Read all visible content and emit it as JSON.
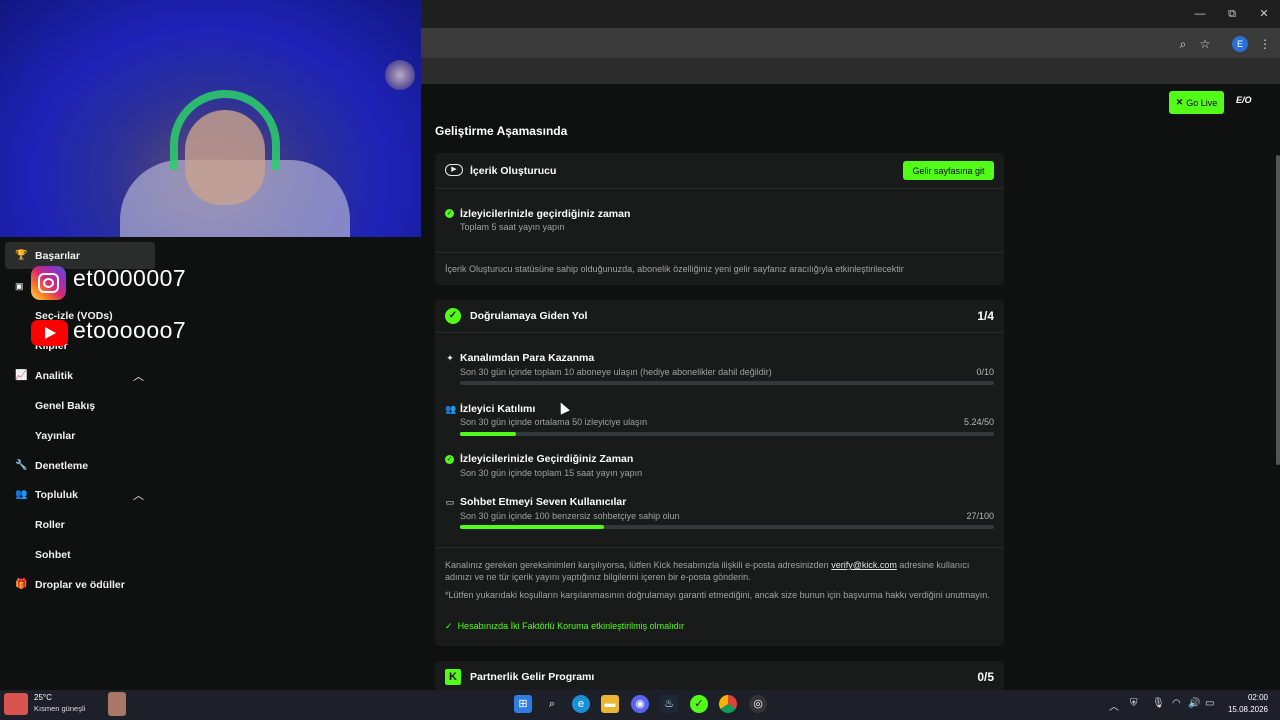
{
  "browser": {
    "window_controls": {
      "minimize": "—",
      "restore": "⧉",
      "close": "✕"
    },
    "toolbar": {
      "zoom_icon": "zoom-icon",
      "bookmark_icon": "star-icon",
      "profile_initial": "E",
      "menu_icon": "kebab-icon"
    }
  },
  "header": {
    "go_live_label": "Go Live",
    "logo_text": "E/O"
  },
  "sidebar": {
    "items": [
      {
        "label": "Başarılar",
        "icon": "trophy-icon"
      },
      {
        "label": "Seç-izle (VODs)"
      },
      {
        "label": "Klipler"
      },
      {
        "label": "Analitik",
        "icon": "chart-icon"
      },
      {
        "label": "Genel Bakış"
      },
      {
        "label": "Yayınlar"
      },
      {
        "label": "Denetleme",
        "icon": "wrench-icon"
      },
      {
        "label": "Topluluk",
        "icon": "people-icon"
      },
      {
        "label": "Roller"
      },
      {
        "label": "Sohbet"
      },
      {
        "label": "Droplar ve ödüller",
        "icon": "gift-icon"
      }
    ]
  },
  "overlay": {
    "instagram_handle": "et0000007",
    "youtube_handle": "etoooooo7"
  },
  "main": {
    "section_title": "Geliştirme Aşamasında",
    "creator_card": {
      "title": "İçerik Oluşturucu",
      "button_label": "Gelir sayfasına git",
      "req_title": "İzleyicilerinizle geçirdiğiniz zaman",
      "req_sub": "Toplam 5 saat yayın yapın",
      "footer": "İçerik Oluşturucu statüsüne sahip olduğunuzda, abonelik özelliğiniz yeni gelir sayfanız aracılığıyla etkinleştirilecektir"
    },
    "verify_card": {
      "title": "Doğrulamaya Giden Yol",
      "progress": "1/4",
      "requirements": [
        {
          "title": "Kanalımdan Para Kazanma",
          "sub": "Son 30 gün içinde toplam 10 aboneye ulaşın (hediye abonelikler dahil değildir)",
          "count": "0/10",
          "fraction": 0
        },
        {
          "title": "İzleyici Katılımı",
          "sub": "Son 30 gün içinde ortalama 50 izleyiciye ulaşın",
          "count": "5.24/50",
          "fraction": 0.1048
        },
        {
          "title": "İzleyicilerinizle Geçirdiğiniz Zaman",
          "sub": "Son 30 gün içinde toplam 15 saat yayın yapın",
          "count": "",
          "fraction": null
        },
        {
          "title": "Sohbet Etmeyi Seven Kullanıcılar",
          "sub": "Son 30 gün içinde 100 benzersiz sohbetçiye sahip olun",
          "count": "27/100",
          "fraction": 0.27
        }
      ],
      "note_pre": "Kanalınız gereken gereksinimleri karşılıyorsa, lütfen Kick hesabınızla ilişkili e-posta adresinizden",
      "note_link": "verify@kick.com",
      "note_post": "adresine kullanıcı adınızı ve ne tür içerik yayını yaptığınız bilgilerini içeren bir e-posta gönderin.",
      "disclaimer": "*Lütfen yukarıdaki koşulların karşılanmasının doğrulamayı garanti etmediğini, ancak size bunun için başvurma hakkı verdiğini unutmayın.",
      "two_factor": "Hesabınızda İki Faktörlü Koruma etkinleştirilmiş olmalıdır"
    },
    "partner_card": {
      "title": "Partnerlik Gelir Programı",
      "progress": "0/5"
    }
  },
  "taskbar": {
    "weather_temp": "25°C",
    "weather_desc": "Kısmen güneşli",
    "clock_time": "02:00",
    "clock_date": "15.08.2026"
  },
  "colors": {
    "accent": "#53fc18",
    "card": "#181b1a",
    "background": "#0f1110"
  }
}
